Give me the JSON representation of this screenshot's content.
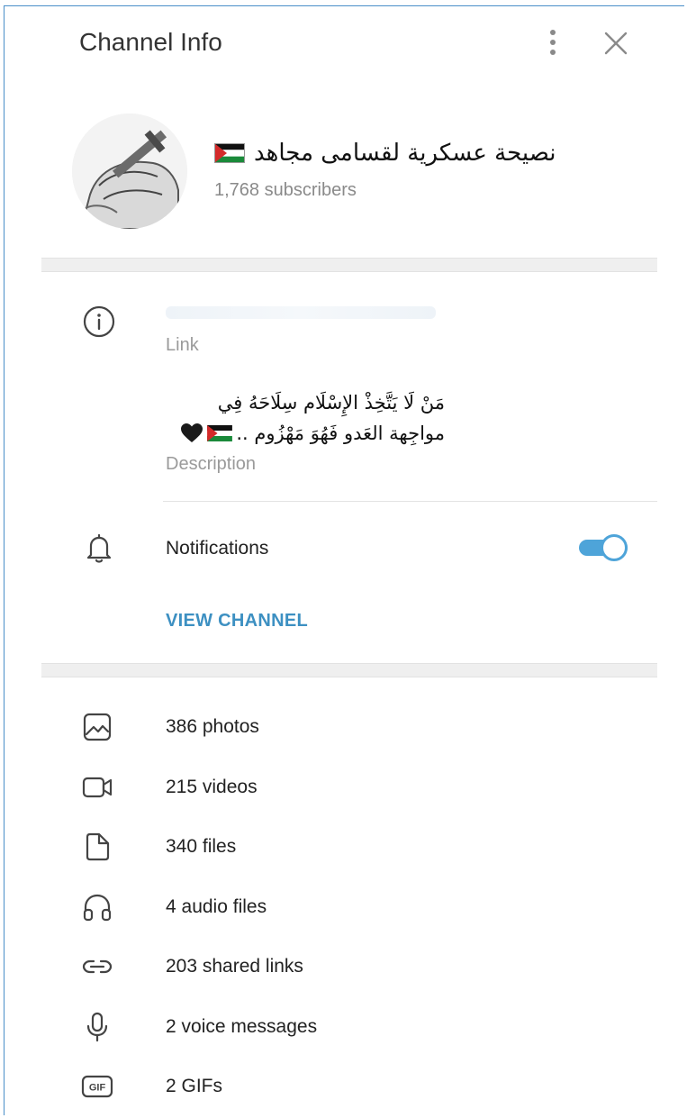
{
  "header": {
    "title": "Channel Info"
  },
  "channel": {
    "name": "نصيحة عسكرية لقسامى مجاهد",
    "subscribers": "1,768 subscribers"
  },
  "info": {
    "link_label": "Link",
    "description_line1": "مَنْ لَا يَتَّخِذْ الإِسْلَام سِلَاحَهُ فِي",
    "description_line2": "مواجِهة العَدو فَهُوَ مَهْزُوم ..",
    "description_label": "Description"
  },
  "notifications": {
    "label": "Notifications",
    "enabled": true
  },
  "actions": {
    "view_channel": "VIEW CHANNEL"
  },
  "media": [
    {
      "label": "386 photos",
      "icon": "photo-icon"
    },
    {
      "label": "215 videos",
      "icon": "video-icon"
    },
    {
      "label": "340 files",
      "icon": "file-icon"
    },
    {
      "label": "4 audio files",
      "icon": "headphones-icon"
    },
    {
      "label": "203 shared links",
      "icon": "link-icon"
    },
    {
      "label": "2 voice messages",
      "icon": "microphone-icon"
    },
    {
      "label": "2 GIFs",
      "icon": "gif-icon"
    }
  ],
  "colors": {
    "accent": "#3d90c2",
    "toggle": "#4ea4d9",
    "secondary_text": "#8a8a8a"
  }
}
